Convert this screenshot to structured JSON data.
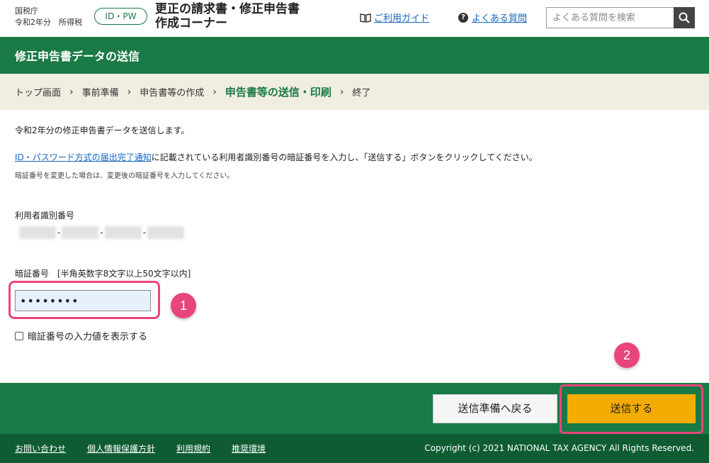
{
  "header": {
    "agency_line1": "国税庁",
    "agency_line2": "令和2年分　所得税",
    "badge": "ID・PW",
    "title_line1": "更正の請求書・修正申告書",
    "title_line2": "作成コーナー",
    "guide_link": "ご利用ガイド",
    "faq_link": "よくある質問",
    "search_placeholder": "よくある質問を検索"
  },
  "page_title": "修正申告書データの送信",
  "breadcrumb": {
    "items": [
      "トップ画面",
      "事前準備",
      "申告書等の作成",
      "申告書等の送信・印刷",
      "終了"
    ],
    "current_index": 3
  },
  "content": {
    "intro": "令和2年分の修正申告書データを送信します。",
    "instruction_link": "ID・パスワード方式の届出完了通知",
    "instruction_rest": "に記載されている利用者識別番号の暗証番号を入力し、「送信する」ボタンをクリックしてください。",
    "note": "暗証番号を変更した場合は、変更後の暗証番号を入力してください。",
    "user_id_label": "利用者識別番号",
    "user_id_separator": "-",
    "pin_label": "暗証番号　[半角英数字8文字以上50文字以内]",
    "pin_value": "••••••••",
    "show_pin_label": "暗証番号の入力値を表示する",
    "step1": "1",
    "step2": "2"
  },
  "actions": {
    "back_label": "送信準備へ戻る",
    "send_label": "送信する"
  },
  "footer": {
    "links": [
      "お問い合わせ",
      "個人情報保護方針",
      "利用規約",
      "推奨環境"
    ],
    "copyright": "Copyright (c) 2021 NATIONAL TAX AGENCY All Rights Reserved."
  },
  "colors": {
    "brand_green": "#1a7a45",
    "footer_green": "#0f5c33",
    "highlight_pink": "#e8457a",
    "send_yellow": "#f4ac00",
    "link_blue": "#1565c0"
  }
}
